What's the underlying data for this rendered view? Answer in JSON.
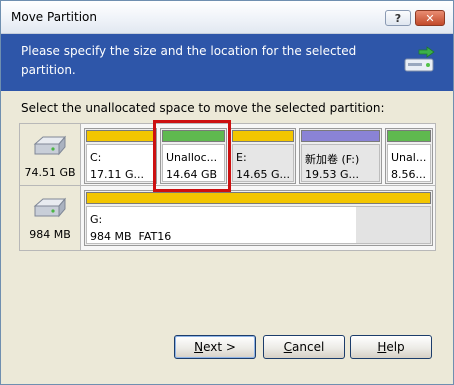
{
  "window": {
    "title": "Move Partition",
    "help_btn": "?",
    "close_btn": "✕"
  },
  "header": {
    "text": "Please specify the size and the location for the selected partition.",
    "icon": "partition-move-icon"
  },
  "instruction": "Select the unallocated space to move the selected partition:",
  "disks": [
    {
      "size": "74.51 GB",
      "partitions": [
        {
          "name": "C:",
          "size": "17.11 G...",
          "bar_color": "#f3c600"
        },
        {
          "name": "Unalloc...",
          "size": "14.64 GB",
          "bar_color": "#5fb94f",
          "selected": true
        },
        {
          "name": "E:",
          "size": "14.65 G...",
          "bar_color": "#f3c600"
        },
        {
          "name": "新加卷 (F:)",
          "size": "19.53 G...",
          "bar_color": "#8a83d6"
        },
        {
          "name": "Unal...",
          "size": "8.56...",
          "bar_color": "#5fb94f"
        }
      ]
    },
    {
      "size": "984 MB",
      "partitions": [
        {
          "name": "G:",
          "size": "984 MB",
          "fs": "FAT16",
          "bar_color": "#f3c600"
        }
      ]
    }
  ],
  "buttons": {
    "next": {
      "mnemonic": "N",
      "rest": "ext >"
    },
    "cancel": {
      "mnemonic": "C",
      "rest": "ancel"
    },
    "help": {
      "mnemonic": "H",
      "rest": "elp"
    }
  }
}
